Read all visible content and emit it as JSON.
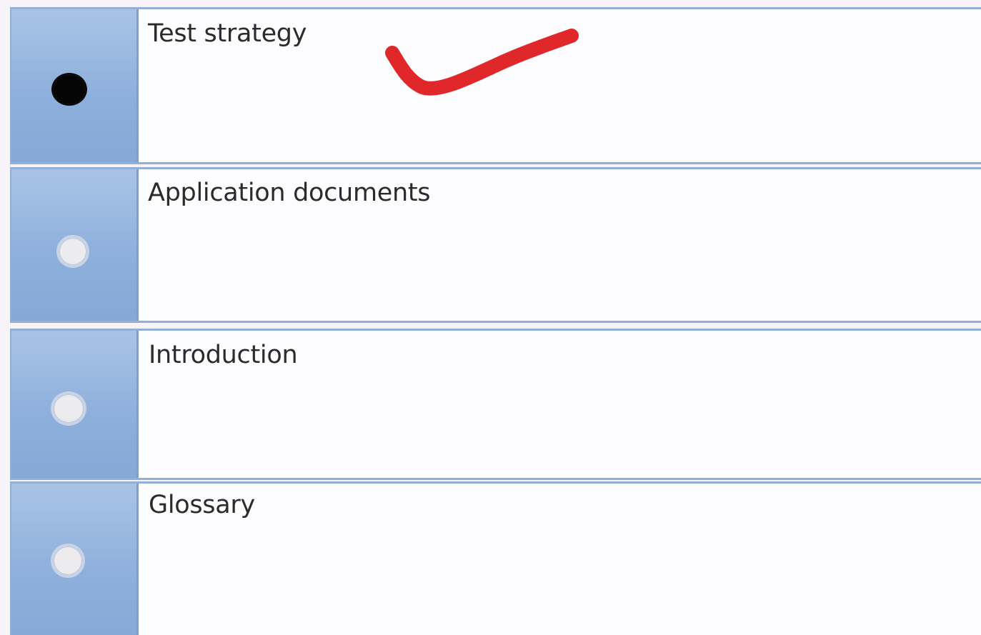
{
  "options": [
    {
      "label": "Test strategy",
      "selected": true
    },
    {
      "label": "Application documents",
      "selected": false
    },
    {
      "label": "Introduction",
      "selected": false
    },
    {
      "label": "Glossary",
      "selected": false
    }
  ],
  "annotation": {
    "type": "checkmark",
    "color": "#e0282a",
    "marks_option": "Test strategy"
  },
  "colors": {
    "selector_fill": "#8eb0dc",
    "border": "#93afd6",
    "row_background": "#fdfcff",
    "text": "#2b2b2b"
  }
}
